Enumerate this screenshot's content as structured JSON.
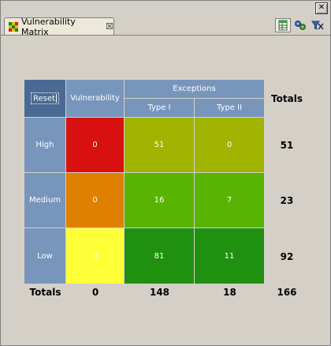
{
  "tab": {
    "label": "Vulnerability Matrix"
  },
  "colors": {
    "header": "#7896bc",
    "reset_header": "#4a6a94",
    "high_vuln": "#d81010",
    "medium_vuln": "#e08000",
    "low_vuln": "#ffff38",
    "high_exc": "#a0b400",
    "medium_exc": "#58b400",
    "low_exc": "#209010"
  },
  "matrix": {
    "reset_label": "Reset",
    "vulnerability_header": "Vulnerability",
    "exceptions_header": "Exceptions",
    "type1_header": "Type I",
    "type2_header": "Type II",
    "totals_header": "Totals",
    "rows": [
      {
        "label": "High",
        "vulnerability": "0",
        "type1": "51",
        "type2": "0",
        "total": "51"
      },
      {
        "label": "Medium",
        "vulnerability": "0",
        "type1": "16",
        "type2": "7",
        "total": "23"
      },
      {
        "label": "Low",
        "vulnerability": "0",
        "type1": "81",
        "type2": "11",
        "total": "92"
      }
    ],
    "footer": {
      "label": "Totals",
      "vulnerability": "0",
      "type1": "148",
      "type2": "18",
      "grand_total": "166"
    }
  }
}
